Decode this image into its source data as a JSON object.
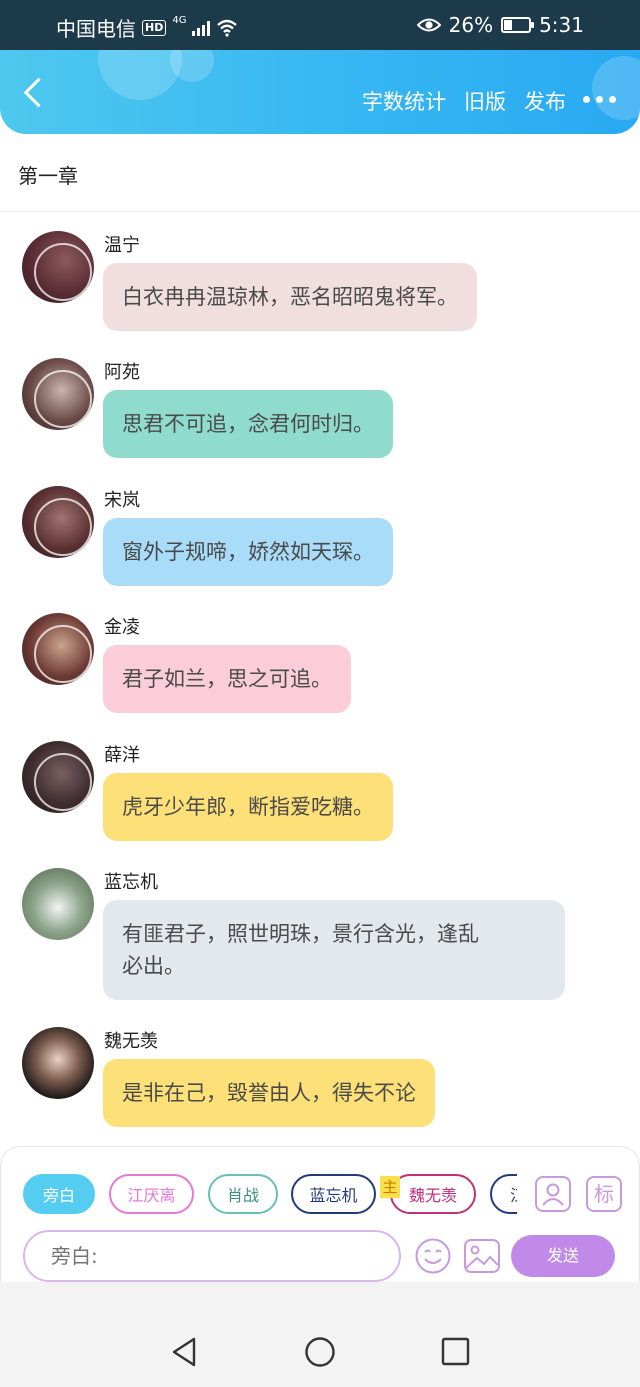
{
  "status_bar": {
    "carrier": "中国电信",
    "hd": "HD",
    "network": "4G",
    "battery": "26%",
    "time": "5:31"
  },
  "header": {
    "actions": [
      "字数统计",
      "旧版",
      "发布"
    ]
  },
  "chapter_title": "第一章",
  "messages": [
    {
      "name": "温宁",
      "text": "白衣冉冉温琼林，恶名昭昭鬼将军。",
      "bubble_color": "#f1dfe0"
    },
    {
      "name": "阿苑",
      "text": "思君不可追，念君何时归。",
      "bubble_color": "#8fdccf"
    },
    {
      "name": "宋岚",
      "text": "窗外子规啼，娇然如天琛。",
      "bubble_color": "#a9dcf8"
    },
    {
      "name": "金凌",
      "text": "君子如兰，思之可追。",
      "bubble_color": "#fbcdd8"
    },
    {
      "name": "薛洋",
      "text": "虎牙少年郎，断指爱吃糖。",
      "bubble_color": "#fde078"
    },
    {
      "name": "蓝忘机",
      "text_line1": "有匪君子，照世明珠，景行含光，逢乱",
      "text_line2": "必出。",
      "bubble_color": "#e3e8ef"
    },
    {
      "name": "魏无羡",
      "text": "是非在己，毁誉由人，得失不论",
      "bubble_color": "#fde078"
    }
  ],
  "role_chips": [
    {
      "label": "旁白",
      "color": "#55cdf1"
    },
    {
      "label": "江厌离",
      "color": "#e27ad6"
    },
    {
      "label": "肖战",
      "color": "#69bfb6"
    },
    {
      "label": "蓝忘机",
      "color": "#233a7a"
    },
    {
      "label": "魏无羡",
      "color": "#c22f7a"
    },
    {
      "label": "江",
      "color": "#233a7a"
    }
  ],
  "main_tag": "主",
  "role_icon_label": "标",
  "composer": {
    "placeholder": "旁白:",
    "send_label": "发送"
  }
}
